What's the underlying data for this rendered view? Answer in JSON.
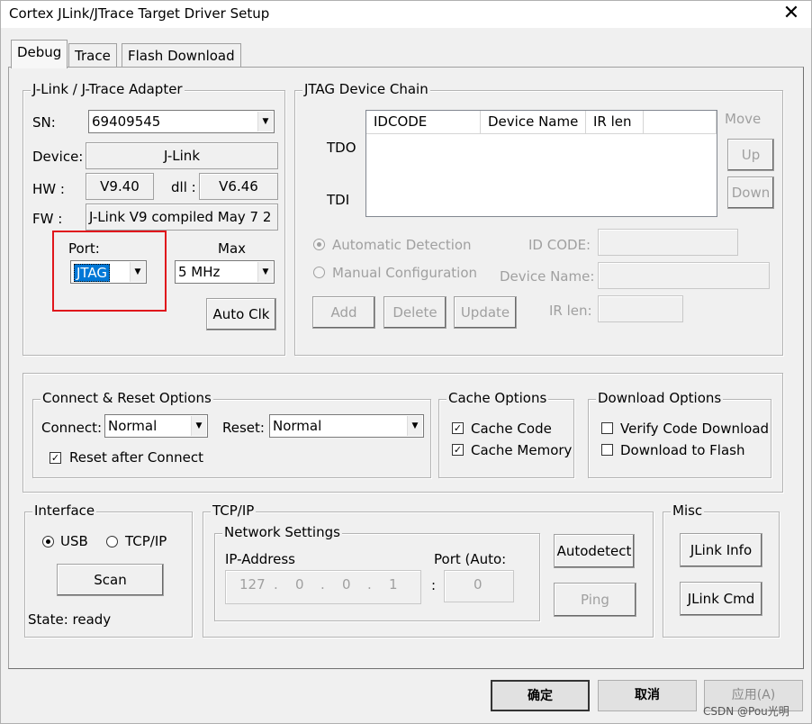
{
  "window": {
    "title": "Cortex JLink/JTrace Target Driver Setup",
    "close_glyph": "✕"
  },
  "tabs": [
    {
      "label": "Debug",
      "active": true
    },
    {
      "label": "Trace",
      "active": false
    },
    {
      "label": "Flash Download",
      "active": false
    }
  ],
  "adapter": {
    "title": "J-Link / J-Trace Adapter",
    "sn_label": "SN:",
    "sn_value": "69409545",
    "device_label": "Device:",
    "device_value": "J-Link",
    "hw_label": "HW :",
    "hw_value": "V9.40",
    "dll_label": "dll :",
    "dll_value": "V6.46",
    "fw_label": "FW :",
    "fw_value": "J-Link V9 compiled May  7 2",
    "port_label": "Port:",
    "port_value": "JTAG",
    "max_label": "Max",
    "max_value": "5 MHz",
    "auto_clk_label": "Auto Clk"
  },
  "jtag_chain": {
    "title": "JTAG Device Chain",
    "columns": [
      "IDCODE",
      "Device Name",
      "IR len"
    ],
    "tdo_label": "TDO",
    "tdi_label": "TDI",
    "move_label": "Move",
    "up_label": "Up",
    "down_label": "Down",
    "auto_detection_label": "Automatic Detection",
    "manual_config_label": "Manual Configuration",
    "id_code_label": "ID CODE:",
    "device_name_label": "Device Name:",
    "ir_len_label": "IR len:",
    "add_label": "Add",
    "delete_label": "Delete",
    "update_label": "Update"
  },
  "connect_reset": {
    "title": "Connect & Reset Options",
    "connect_label": "Connect:",
    "connect_value": "Normal",
    "reset_label": "Reset:",
    "reset_value": "Normal",
    "reset_after_connect_label": "Reset after Connect",
    "reset_after_connect_checked": true
  },
  "cache_options": {
    "title": "Cache Options",
    "cache_code_label": "Cache Code",
    "cache_code_checked": true,
    "cache_memory_label": "Cache Memory",
    "cache_memory_checked": true
  },
  "download_options": {
    "title": "Download Options",
    "verify_label": "Verify Code Download",
    "verify_checked": false,
    "download_flash_label": "Download to Flash",
    "download_flash_checked": false
  },
  "interface": {
    "title": "Interface",
    "usb_label": "USB",
    "usb_selected": true,
    "tcpip_label": "TCP/IP",
    "tcpip_selected": false,
    "scan_label": "Scan",
    "state_label": "State: ready"
  },
  "tcpip": {
    "title": "TCP/IP",
    "network_settings_title": "Network Settings",
    "ip_address_label": "IP-Address",
    "port_auto_label": "Port (Auto:",
    "ip_octets": [
      "127",
      "0",
      "0",
      "1"
    ],
    "ip_dot": ".",
    "port_colon": ":",
    "port_value": "0",
    "autodetect_label": "Autodetect",
    "ping_label": "Ping"
  },
  "misc": {
    "title": "Misc",
    "jlink_info_label": "JLink Info",
    "jlink_cmd_label": "JLink Cmd"
  },
  "footer": {
    "ok_label": "确定",
    "cancel_label": "取消",
    "apply_label": "应用(A)",
    "watermark": "CSDN @Pou光明"
  },
  "colors": {
    "highlight_box": "#e0161c",
    "selection": "#0078d7"
  }
}
